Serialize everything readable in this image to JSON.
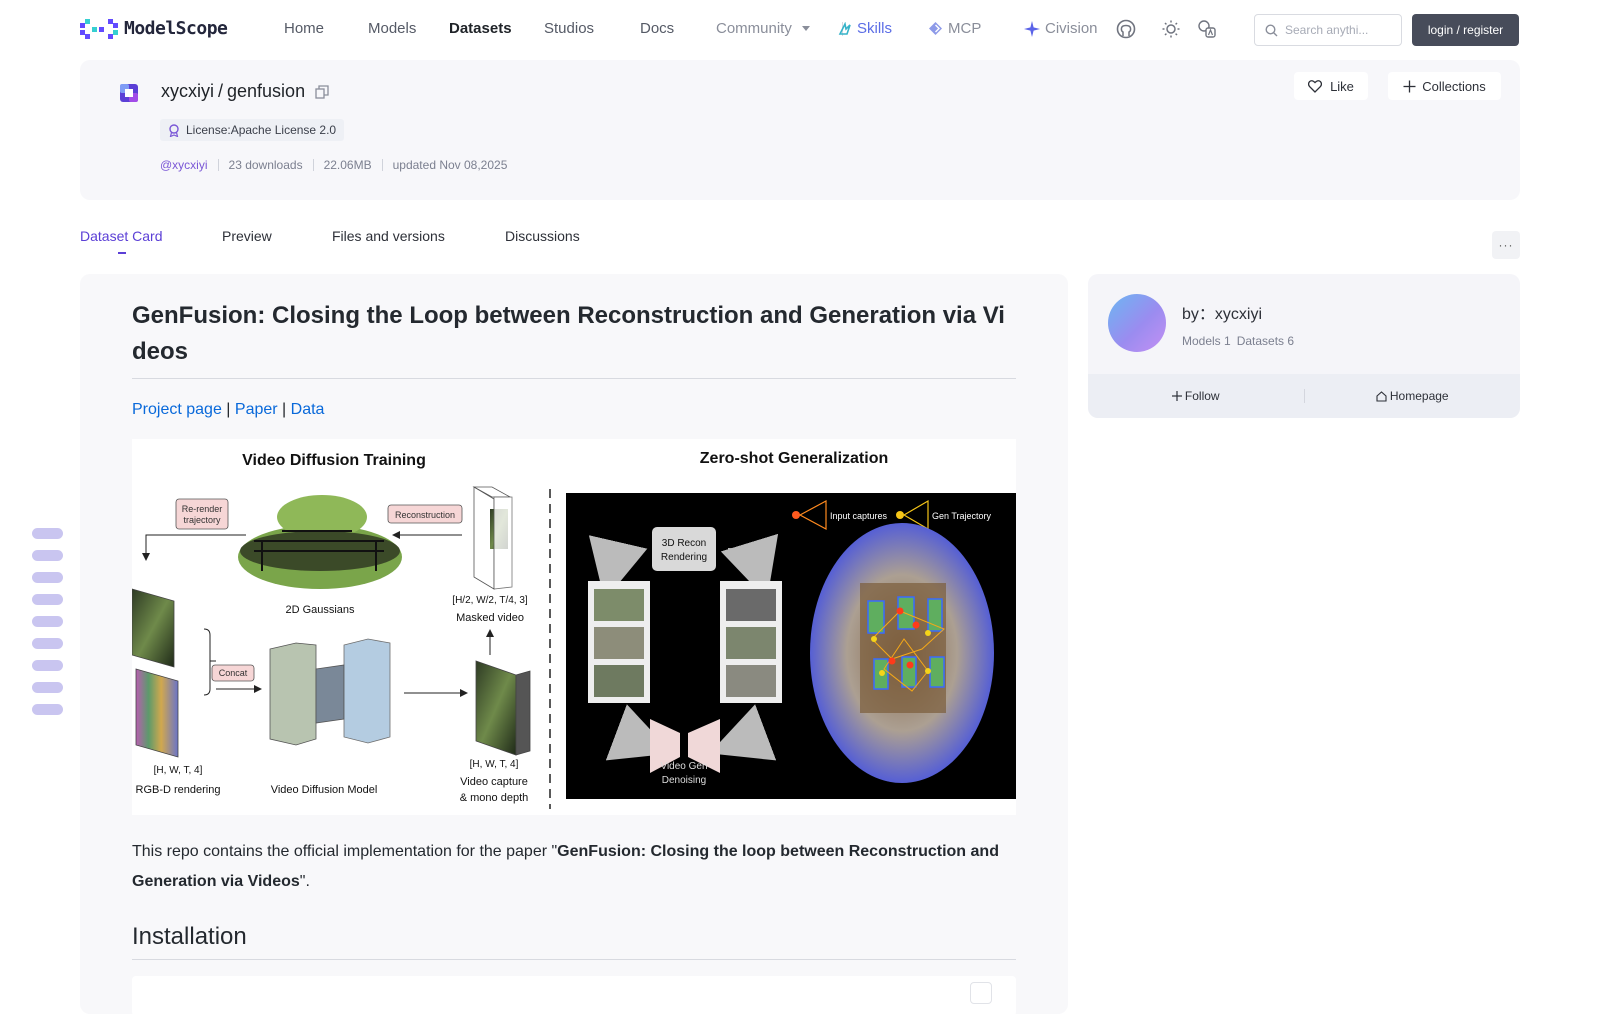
{
  "nav": {
    "logo_text": "ModelScope",
    "links": [
      "Home",
      "Models",
      "Datasets",
      "Studios",
      "Docs"
    ],
    "community": "Community",
    "skills": "Skills",
    "mcp": "MCP",
    "civision": "Civision",
    "search_placeholder": "Search anythi...",
    "login": "login / register",
    "colors": {
      "accent": "#5b3fd6",
      "skills": "#5b6de6",
      "login_bg": "#474c5a"
    },
    "icons": [
      "github-icon",
      "theme-sun-icon",
      "language-icon",
      "search-icon"
    ]
  },
  "repo": {
    "owner": "xycxiyi",
    "separator": "/",
    "name": "genfusion",
    "license": "License:Apache License 2.0",
    "author_handle": "@xycxiyi",
    "downloads": "23 downloads",
    "size": "22.06MB",
    "updated": "updated Nov 08,2025",
    "like": "Like",
    "collections": "Collections"
  },
  "tabs": [
    "Dataset Card",
    "Preview",
    "Files and versions",
    "Discussions"
  ],
  "more": "···",
  "card": {
    "title": "GenFusion: Closing the Loop between Reconstruction and Generation via Videos",
    "links": [
      "Project page",
      "Paper",
      "Data"
    ],
    "link_sep": " | ",
    "figure": {
      "left_title": "Video Diffusion Training",
      "right_title": "Zero-shot Generalization",
      "labels": {
        "rerender": [
          "Re-render",
          "trajectory"
        ],
        "reconstruction": "Reconstruction",
        "gaussians": "2D Gaussians",
        "dims_masked": "[H/2, W/2, T/4, 3]",
        "masked_video": "Masked video",
        "concat": "Concat",
        "dims_rgbd": "[H, W, T, 4]",
        "rgbd": "RGB-D rendering",
        "vdm": "Video Diffusion Model",
        "dims_capture": "[H, W, T, 4]",
        "capture": [
          "Video capture",
          "& mono depth"
        ],
        "recon": [
          "3D Recon",
          "Rendering"
        ],
        "gen": [
          "Video Gen",
          "Denoising"
        ],
        "input_captures": "Input captures",
        "gen_traj": "Gen Trajectory"
      }
    },
    "para_prefix": "This repo contains the official implementation for the paper \"",
    "para_bold": "GenFusion: Closing the loop between Reconstruction and Generation via Videos",
    "para_suffix": "\".",
    "h2": "Installation"
  },
  "author": {
    "by": "by：",
    "name": "xycxiyi",
    "models": "Models 1",
    "datasets": "Datasets 6",
    "follow": "Follow",
    "homepage": "Homepage"
  },
  "toc_count": 9
}
